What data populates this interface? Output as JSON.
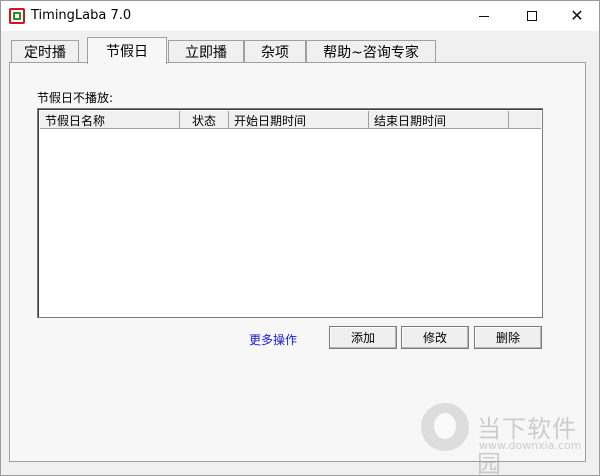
{
  "window": {
    "title": "TimingLaba 7.0",
    "minimize_symbol": "—",
    "maximize_symbol": "☐",
    "close_symbol": "✕"
  },
  "tabs": [
    {
      "label": "定时播",
      "active": false
    },
    {
      "label": "节假日",
      "active": true
    },
    {
      "label": "立即播",
      "active": false
    },
    {
      "label": "杂项",
      "active": false
    },
    {
      "label": "帮助~咨询专家",
      "active": false
    }
  ],
  "panel": {
    "section_label": "节假日不播放:",
    "list": {
      "columns": [
        "节假日名称",
        "状态",
        "开始日期时间",
        "结束日期时间",
        ""
      ],
      "rows": []
    },
    "more_link": "更多操作",
    "buttons": {
      "add": "添加",
      "edit": "修改",
      "delete": "删除"
    }
  },
  "watermark": {
    "text_cn": "当下软件园",
    "url": "www.downxia.com"
  },
  "colors": {
    "link": "#1a1ad6",
    "window_bg": "#f0f0f0",
    "icon_red": "#d01818",
    "icon_green": "#2a8c2a"
  }
}
